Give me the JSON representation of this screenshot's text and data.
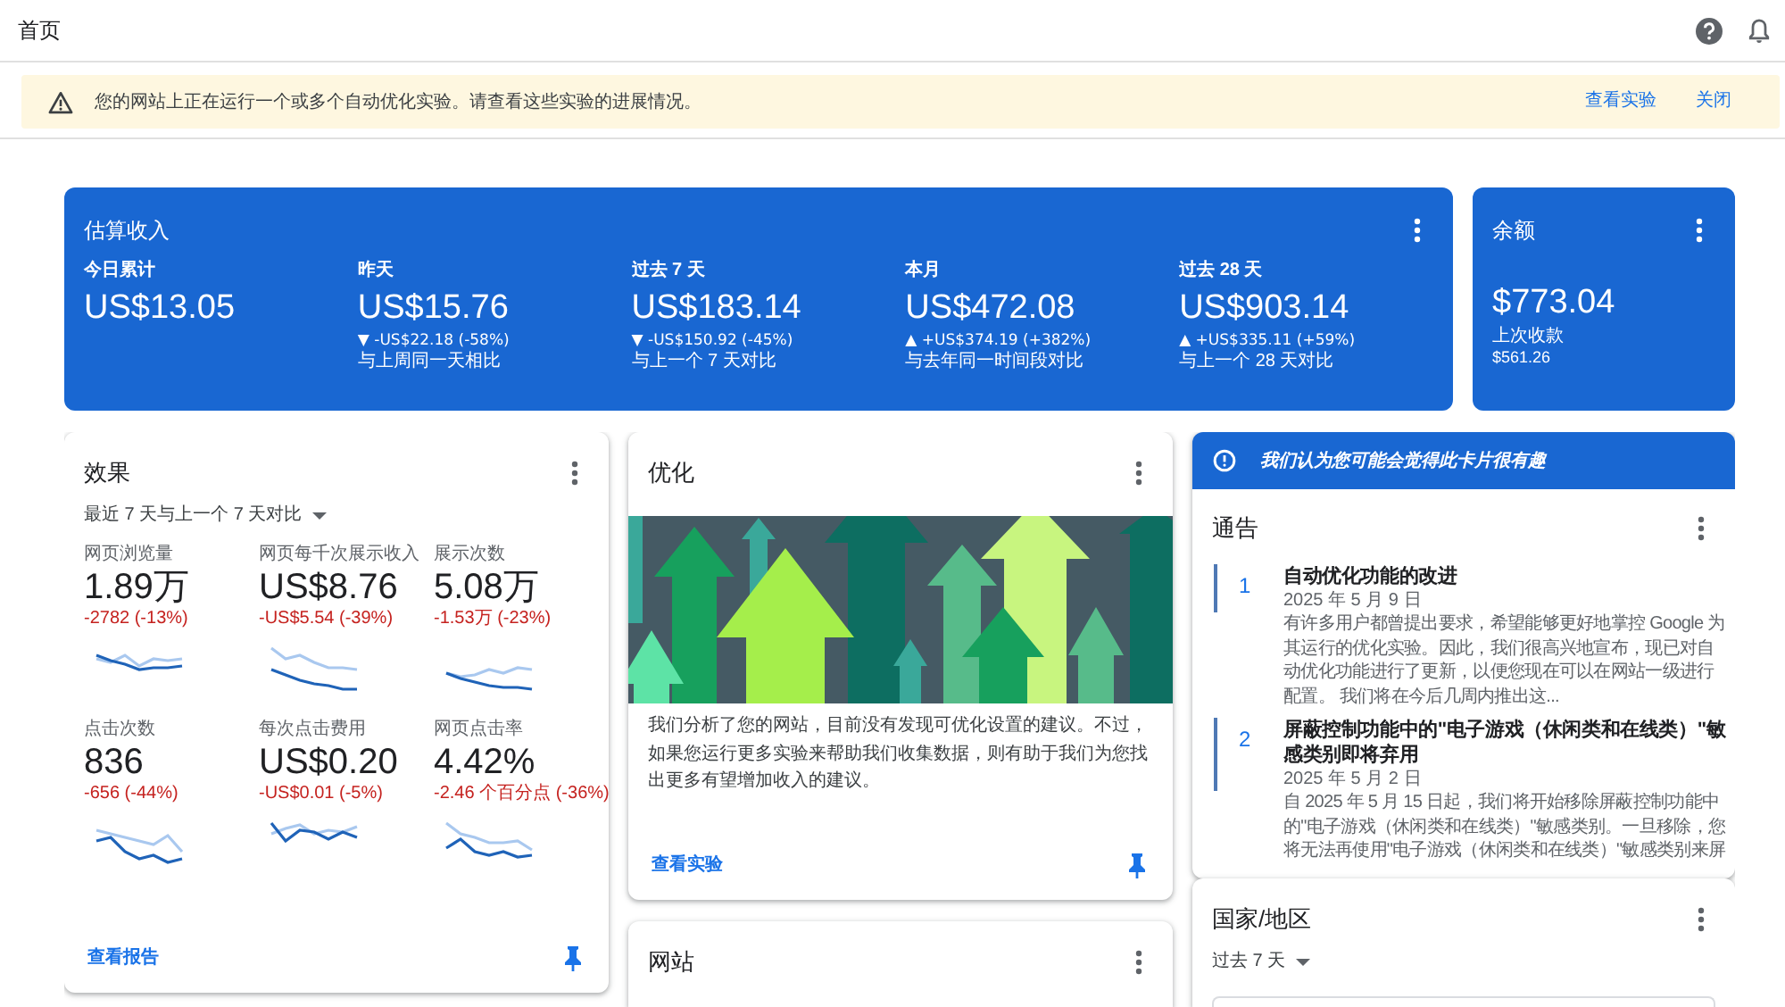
{
  "header": {
    "title": "首页"
  },
  "experiment_banner": {
    "message": "您的网站上正在运行一个或多个自动优化实验。请查看这些实验的进展情况。",
    "actions": [
      "查看实验",
      "关闭"
    ]
  },
  "estimated_earnings": {
    "title": "估算收入",
    "metrics": [
      {
        "label": "今日累计",
        "value": "US$13.05"
      },
      {
        "label": "昨天",
        "value": "US$15.76",
        "change": "▼ -US$22.18 (-58%)",
        "comparison": "与上周同一天相比"
      },
      {
        "label": "过去 7 天",
        "value": "US$183.14",
        "change": "▼ -US$150.92 (-45%)",
        "comparison": "与上一个 7 天对比"
      },
      {
        "label": "本月",
        "value": "US$472.08",
        "change": "▲ +US$374.19 (+382%)",
        "comparison": "与去年同一时间段对比"
      },
      {
        "label": "过去 28 天",
        "value": "US$903.14",
        "change": "▲ +US$335.11 (+59%)",
        "comparison": "与上一个 28 天对比"
      }
    ]
  },
  "balance": {
    "title": "余额",
    "value": "$773.04",
    "last_payment_label": "上次收款",
    "last_payment": "$561.26"
  },
  "performance": {
    "title": "效果",
    "period": "最近 7 天与上一个 7 天对比",
    "metrics": [
      {
        "label": "网页浏览量",
        "value": "1.89万",
        "change": "-2782 (-13%)"
      },
      {
        "label": "网页每千次展示收入",
        "value": "US$8.76",
        "change": "-US$5.54 (-39%)"
      },
      {
        "label": "展示次数",
        "value": "5.08万",
        "change": "-1.53万 (-23%)"
      },
      {
        "label": "点击次数",
        "value": "836",
        "change": "-656 (-44%)"
      },
      {
        "label": "每次点击费用",
        "value": "US$0.20",
        "change": "-US$0.01 (-5%)"
      },
      {
        "label": "网页点击率",
        "value": "4.42%",
        "change": "-2.46 个百分点 (-36%)"
      }
    ],
    "link": "查看报告",
    "pinned": true
  },
  "optimization": {
    "title": "优化",
    "description": "我们分析了您的网站，目前没有发现可优化设置的建议。不过，如果您运行更多实验来帮助我们收集数据，则有助于我们为您找出更多有望增加收入的建议。",
    "link": "查看实验",
    "pinned": true
  },
  "sites": {
    "title": "网站"
  },
  "suggestion_banner": {
    "text": "我们认为您可能会觉得此卡片很有趣"
  },
  "announcements": {
    "title": "通告",
    "items": [
      {
        "number": "1",
        "title": "自动优化功能的改进",
        "date": "2025 年 5 月 9 日",
        "body": "有许多用户都曾提出要求，希望能够更好地掌控 Google 为其运行的优化实验。因此，我们很高兴地宣布，现已对自动优化功能进行了更新，以便您现在可以在网站一级进行配置。 我们将在今后几周内推出这..."
      },
      {
        "number": "2",
        "title": "屏蔽控制功能中的\"电子游戏（休闲类和在线类）\"敏感类别即将弃用",
        "date": "2025 年 5 月 2 日",
        "body": "自 2025 年 5 月 15 日起，我们将开始移除屏蔽控制功能中的\"电子游戏（休闲类和在线类）\"敏感类别。一旦移除，您将无法再使用\"电子游戏（休闲类和在线类）\"敏感类别来屏"
      }
    ]
  },
  "countries": {
    "title": "国家/地区",
    "period": "过去 7 天"
  }
}
